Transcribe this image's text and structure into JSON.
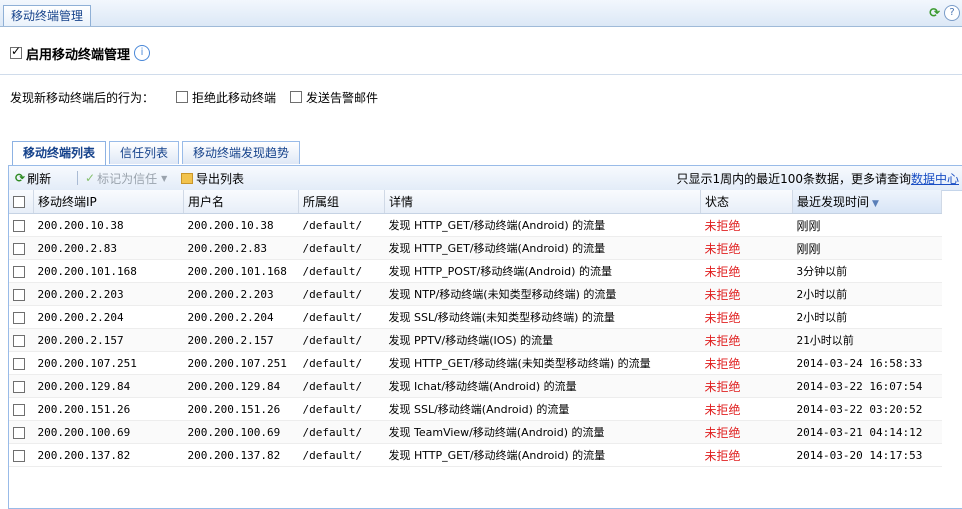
{
  "window": {
    "title": "移动终端管理"
  },
  "enable": {
    "label": "启用移动终端管理",
    "checked": true
  },
  "behavior": {
    "label": "发现新移动终端后的行为：",
    "options": [
      {
        "label": "拒绝此移动终端",
        "checked": false
      },
      {
        "label": "发送告警邮件",
        "checked": false
      }
    ]
  },
  "tabs": [
    {
      "label": "移动终端列表",
      "active": true
    },
    {
      "label": "信任列表",
      "active": false
    },
    {
      "label": "移动终端发现趋势",
      "active": false
    }
  ],
  "toolbar": {
    "refresh_label": "刷新",
    "mark_trust_label": "标记为信任",
    "export_label": "导出列表",
    "info_text": "只显示1周内的最近100条数据，更多请查询",
    "info_link": "数据中心"
  },
  "table": {
    "columns": [
      "移动终端IP",
      "用户名",
      "所属组",
      "详情",
      "状态",
      "最近发现时间"
    ],
    "rows": [
      [
        "200.200.10.38",
        "200.200.10.38",
        "/default/",
        "发现 HTTP_GET/移动终端(Android) 的流量",
        "未拒绝",
        "刚刚"
      ],
      [
        "200.200.2.83",
        "200.200.2.83",
        "/default/",
        "发现 HTTP_GET/移动终端(Android) 的流量",
        "未拒绝",
        "刚刚"
      ],
      [
        "200.200.101.168",
        "200.200.101.168",
        "/default/",
        "发现 HTTP_POST/移动终端(Android) 的流量",
        "未拒绝",
        "3分钟以前"
      ],
      [
        "200.200.2.203",
        "200.200.2.203",
        "/default/",
        "发现 NTP/移动终端(未知类型移动终端) 的流量",
        "未拒绝",
        "2小时以前"
      ],
      [
        "200.200.2.204",
        "200.200.2.204",
        "/default/",
        "发现 SSL/移动终端(未知类型移动终端) 的流量",
        "未拒绝",
        "2小时以前"
      ],
      [
        "200.200.2.157",
        "200.200.2.157",
        "/default/",
        "发现 PPTV/移动终端(IOS) 的流量",
        "未拒绝",
        "21小时以前"
      ],
      [
        "200.200.107.251",
        "200.200.107.251",
        "/default/",
        "发现 HTTP_GET/移动终端(未知类型移动终端) 的流量",
        "未拒绝",
        "2014-03-24 16:58:33"
      ],
      [
        "200.200.129.84",
        "200.200.129.84",
        "/default/",
        "发现 Ichat/移动终端(Android) 的流量",
        "未拒绝",
        "2014-03-22 16:07:54"
      ],
      [
        "200.200.151.26",
        "200.200.151.26",
        "/default/",
        "发现 SSL/移动终端(Android) 的流量",
        "未拒绝",
        "2014-03-22 03:20:52"
      ],
      [
        "200.200.100.69",
        "200.200.100.69",
        "/default/",
        "发现 TeamView/移动终端(Android) 的流量",
        "未拒绝",
        "2014-03-21 04:14:12"
      ],
      [
        "200.200.137.82",
        "200.200.137.82",
        "/default/",
        "发现 HTTP_GET/移动终端(Android) 的流量",
        "未拒绝",
        "2014-03-20 14:17:53"
      ]
    ]
  },
  "colors": {
    "status_red": "#e02020",
    "link_blue": "#1a4fc4",
    "header_blue": "#15428b"
  }
}
